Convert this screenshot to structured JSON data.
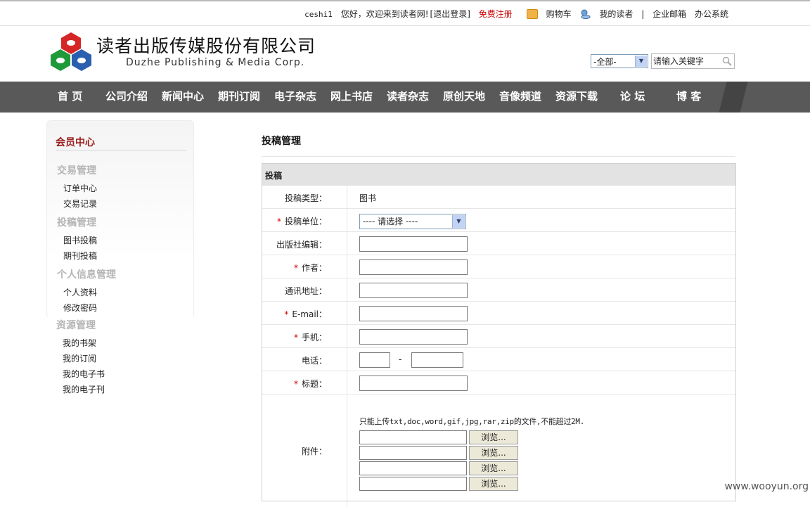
{
  "topbar": {
    "user": "ceshi1",
    "welcome": "您好，欢迎来到读者网!",
    "logout": "[退出登录]",
    "register": "免费注册",
    "cart": "购物车",
    "my_reader": "我的读者",
    "divider": "|",
    "mail": "企业邮箱",
    "office": "办公系统"
  },
  "header": {
    "company_cn": "读者出版传媒股份有限公司",
    "company_en": "Duzhe Publishing & Media Corp.",
    "search_scope": "-全部-",
    "search_placeholder": "请输入关键字"
  },
  "nav": [
    "首 页",
    "公司介绍",
    "新闻中心",
    "期刊订阅",
    "电子杂志",
    "网上书店",
    "读者杂志",
    "原创天地",
    "音像频道",
    "资源下载",
    "论 坛",
    "博 客"
  ],
  "sidebar": {
    "title": "会员中心",
    "groups": [
      {
        "label": "交易管理",
        "links": [
          "订单中心",
          "交易记录"
        ]
      },
      {
        "label": "投稿管理",
        "links": [
          "图书投稿",
          "期刊投稿"
        ]
      },
      {
        "label": "个人信息管理",
        "links": [
          "个人资料",
          "修改密码"
        ]
      },
      {
        "label": "资源管理",
        "links": [
          "我的书架",
          "我的订阅",
          "我的电子书",
          "我的电子刊"
        ]
      }
    ]
  },
  "main": {
    "title": "投稿管理",
    "panel_title": "投稿",
    "fields": {
      "type_label": "投稿类型：",
      "type_value": "图书",
      "unit_label": "投稿单位：",
      "unit_select": "---- 请选择 ----",
      "editor_label": "出版社编辑：",
      "author_label": "作者：",
      "address_label": "通讯地址：",
      "email_label": "E-mail：",
      "mobile_label": "手机：",
      "phone_label": "电话：",
      "phone_dash": "-",
      "title_label": "标题：",
      "attach_label": "附件：",
      "attach_note": "只能上传txt,doc,word,gif,jpg,rar,zip的文件,不能超过2M.",
      "browse": "浏览..."
    },
    "required_mark": "*"
  },
  "watermark": "www.wooyun.org"
}
